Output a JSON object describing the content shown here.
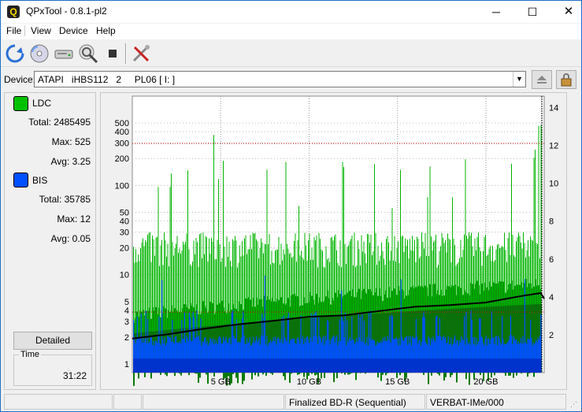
{
  "window": {
    "title": "QPxTool - 0.8.1-pl2",
    "app_icon_glyph": "Q"
  },
  "controls": {
    "minimize": "─",
    "maximize": "☐",
    "close": "✕"
  },
  "menu": [
    "File",
    "View",
    "Device",
    "Help"
  ],
  "toolbar": {
    "icons": [
      "refresh-icon",
      "disc-icon",
      "drive-icon",
      "scan-disc-icon",
      "stop-icon",
      "tools-icon"
    ]
  },
  "device": {
    "label": "Device:",
    "selected": "ATAPI   iHBS112   2     PL06 [ I: ]",
    "buttons": [
      "eject-icon",
      "lock-icon"
    ]
  },
  "stats": {
    "ldc": {
      "name": "LDC",
      "color": "#00c000",
      "total": "Total: 2485495",
      "max": "Max: 525",
      "avg": "Avg: 3.25"
    },
    "bis": {
      "name": "BIS",
      "color": "#0050ff",
      "total": "Total: 35785",
      "max": "Max: 12",
      "avg": "Avg: 0.05"
    }
  },
  "detailed_label": "Detailed",
  "time": {
    "title": "Time",
    "value": "31:22"
  },
  "statusbar": {
    "cells": [
      "",
      "",
      "",
      "Finalized BD-R (Sequential)",
      "VERBAT-IMe/000"
    ]
  },
  "chart_data": {
    "type": "bar",
    "x_unit_ticks": [
      "5 GB",
      "10 GB",
      "15 GB",
      "20 GB"
    ],
    "x_tick_values": [
      5,
      10,
      15,
      20
    ],
    "x_range": [
      0,
      23.3
    ],
    "left_axis": {
      "scale": "log",
      "ticks": [
        "1",
        "2",
        "3",
        "4",
        "5",
        "10",
        "20",
        "30",
        "40",
        "50",
        "100",
        "200",
        "300",
        "400",
        "500"
      ],
      "tick_values": [
        1,
        2,
        3,
        4,
        5,
        10,
        20,
        30,
        40,
        50,
        100,
        200,
        300,
        400,
        500
      ]
    },
    "right_axis": {
      "scale": "linear",
      "ticks": [
        "2",
        "4",
        "6",
        "8",
        "10",
        "12",
        "14"
      ],
      "tick_values": [
        2,
        4,
        6,
        8,
        10,
        12,
        14
      ],
      "range": [
        0,
        14.6
      ]
    },
    "series": [
      {
        "name": "LDC",
        "color": "#00b400",
        "typical": 20,
        "peak": 525
      },
      {
        "name": "BIS",
        "color": "#0050ff",
        "typical": 3,
        "peak": 12
      },
      {
        "name": "speed",
        "color": "#000000",
        "x": [
          0,
          2,
          4,
          6,
          8,
          10,
          12,
          14,
          16,
          18,
          20,
          22,
          23.1,
          23.3
        ],
        "y": [
          1.8,
          2.0,
          2.3,
          2.55,
          2.75,
          2.95,
          3.1,
          3.25,
          3.45,
          3.6,
          3.75,
          4.0,
          4.2,
          3.9
        ]
      }
    ],
    "grid": true,
    "hline_right": 3.2,
    "hline_right_top": 12.1
  }
}
